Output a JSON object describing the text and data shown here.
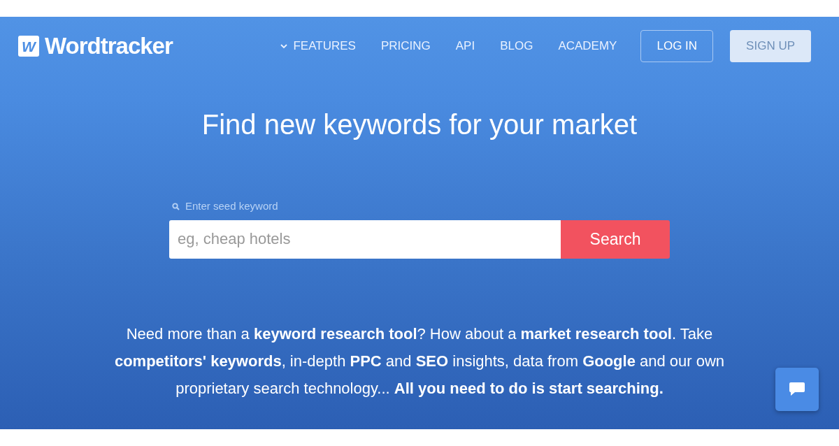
{
  "logo": {
    "mark": "W",
    "name": "Wordtracker"
  },
  "nav": [
    {
      "label": "FEATURES",
      "dropdown": true
    },
    {
      "label": "PRICING",
      "dropdown": false
    },
    {
      "label": "API",
      "dropdown": false
    },
    {
      "label": "BLOG",
      "dropdown": false
    },
    {
      "label": "ACADEMY",
      "dropdown": false
    }
  ],
  "login": "LOG IN",
  "signup": "SIGN UP",
  "headline": "Find new keywords for your market",
  "search": {
    "label": "Enter seed keyword",
    "placeholder": "eg, cheap hotels",
    "button": "Search"
  },
  "description": "Need more than a **keyword research tool**? How about a **market research tool**. Take **competitors' keywords**, in-depth **PPC** and **SEO** insights, data from **Google** and our own proprietary search technology... **All you need to do is start searching.**"
}
